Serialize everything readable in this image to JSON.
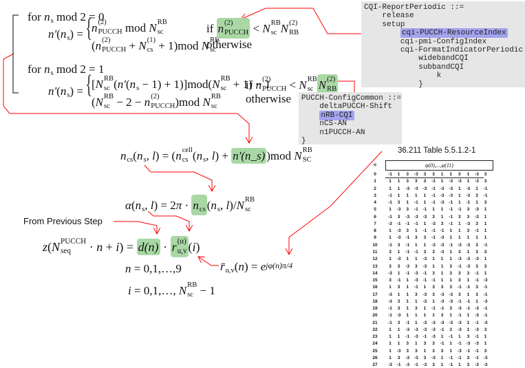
{
  "colors": {
    "highlight_green": "#a9d8a5",
    "highlight_blue": "#a3a3ee",
    "highlight_red": "#e98a86",
    "connector": "#ff0000",
    "code_bg": "#e6e6e6"
  },
  "labels": {
    "for_even": [
      {
        "t": "for "
      },
      {
        "b": "n",
        "sub": "s"
      },
      {
        "t": " mod 2 = 0"
      }
    ],
    "for_odd": [
      {
        "t": "for "
      },
      {
        "b": "n",
        "sub": "s"
      },
      {
        "t": " mod 2 = 1"
      }
    ],
    "from_previous_step": "From Previous  Step"
  },
  "eqs": {
    "nprime_lhs": [
      {
        "b": "n'"
      },
      {
        "t": "("
      },
      {
        "b": "n",
        "sub": "s"
      },
      {
        "t": ") ="
      }
    ],
    "even_case1": [
      {
        "b": "n",
        "sup": "(2)",
        "sub": "PUCCH"
      },
      {
        "t": " mod "
      },
      {
        "b": "N",
        "sup": "RB",
        "sub": "sc"
      }
    ],
    "even_case2": [
      {
        "t": "("
      },
      {
        "b": "n",
        "sup": "(2)",
        "sub": "PUCCH"
      },
      {
        "t": " + "
      },
      {
        "b": "N",
        "sup": "(1)",
        "sub": "cs"
      },
      {
        "t": " + 1)mod "
      },
      {
        "b": "N",
        "sup": "RB",
        "sub": "sc"
      }
    ],
    "even_cond1": [
      {
        "t": "if "
      },
      {
        "b": "n",
        "sup": "(2)",
        "sub": "PUCCH",
        "hl": "green"
      },
      {
        "t": " < "
      },
      {
        "b": "N",
        "sup": "RB",
        "sub": "sc"
      },
      {
        "b": "N",
        "sup": "(2)",
        "sub": "RB"
      }
    ],
    "even_cond2": [
      {
        "t": "otherwise"
      }
    ],
    "odd_case1": [
      {
        "t": "["
      },
      {
        "b": "N",
        "sup": "RB",
        "sub": "sc"
      },
      {
        "t": "("
      },
      {
        "b": "n'"
      },
      {
        "t": "("
      },
      {
        "b": "n",
        "sub": "s"
      },
      {
        "t": " − 1) + 1)]mod("
      },
      {
        "b": "N",
        "sup": "RB",
        "sub": "sc"
      },
      {
        "t": " + 1) − 1"
      }
    ],
    "odd_case2": [
      {
        "t": "("
      },
      {
        "b": "N",
        "sup": "RB",
        "sub": "sc"
      },
      {
        "t": " − 2 − "
      },
      {
        "b": "n",
        "sup": "(2)",
        "sub": "PUCCH"
      },
      {
        "t": ")mod "
      },
      {
        "b": "N",
        "sup": "RB",
        "sub": "sc"
      }
    ],
    "odd_cond1": [
      {
        "t": "if "
      },
      {
        "b": "n",
        "sup": "(2)",
        "sub": "PUCCH"
      },
      {
        "t": " < "
      },
      {
        "b": "N",
        "sup": "RB",
        "sub": "sc"
      },
      {
        "b": "N",
        "sup": "(2)",
        "sub": "RB",
        "hl": "green"
      }
    ],
    "odd_cond2": [
      {
        "t": "otherwise"
      }
    ],
    "ncs": [
      {
        "b": "n",
        "sub": "cs"
      },
      {
        "t": "("
      },
      {
        "b": "n",
        "sub": "s"
      },
      {
        "t": ", "
      },
      {
        "b": "l"
      },
      {
        "t": ") = ("
      },
      {
        "b": "n",
        "sup": "cell",
        "sub": "cs"
      },
      {
        "t": "("
      },
      {
        "b": "n",
        "sub": "s"
      },
      {
        "t": ", "
      },
      {
        "b": "l"
      },
      {
        "t": ") + "
      },
      {
        "b": "n'(n_s)",
        "hl": "green"
      },
      {
        "t": ")mod "
      },
      {
        "b": "N",
        "sup": "RB",
        "sub": "SC"
      }
    ],
    "alpha": [
      {
        "b": "α"
      },
      {
        "t": "("
      },
      {
        "b": "n",
        "sub": "s"
      },
      {
        "t": ", "
      },
      {
        "b": "l"
      },
      {
        "t": ") = 2"
      },
      {
        "b": "π"
      },
      {
        "t": " · "
      },
      {
        "b": "n",
        "sub": "cs",
        "hl": "green"
      },
      {
        "t": "("
      },
      {
        "b": "n",
        "sub": "s"
      },
      {
        "t": ", "
      },
      {
        "b": "l"
      },
      {
        "t": ")/"
      },
      {
        "b": "N",
        "sup": "RB",
        "sub": "sc"
      }
    ],
    "z": [
      {
        "b": "z"
      },
      {
        "t": "("
      },
      {
        "b": "N",
        "sup": "PUCCH",
        "sub": "seq"
      },
      {
        "t": " · "
      },
      {
        "b": "n"
      },
      {
        "t": " + "
      },
      {
        "b": "i"
      },
      {
        "t": ") = "
      },
      {
        "b": "d(n)",
        "hl": "green"
      },
      {
        "t": " · "
      },
      {
        "b": "r",
        "sup": "(α)",
        "sub": "u,v",
        "hl": "green"
      },
      {
        "t": "("
      },
      {
        "b": "i"
      },
      {
        "t": ")"
      }
    ],
    "n_range": [
      {
        "b": "n"
      },
      {
        "t": " = 0,1,…,9"
      }
    ],
    "i_range": [
      {
        "b": "i"
      },
      {
        "t": " = 0,1,…, "
      },
      {
        "b": "N",
        "sup": "RB",
        "sub": "sc"
      },
      {
        "t": " − 1"
      }
    ],
    "rbar": [
      {
        "b": "r̄",
        "sub": "u,v"
      },
      {
        "t": "("
      },
      {
        "b": "n"
      },
      {
        "t": ") = "
      },
      {
        "b": "e"
      },
      {
        "b": "jφ(n)π/4",
        "small": true
      }
    ]
  },
  "cqi_box": {
    "lines": [
      "CQI-ReportPeriodic ::=",
      "    release",
      "    setup",
      "        cqi-PUCCH-ResourceIndex",
      "        cqi-pmi-ConfigIndex",
      "        cqi-FormatIndicatorPeriodic",
      "            widebandCQI",
      "            subbandCQI",
      "                k",
      "            }"
    ],
    "selected_index": 3
  },
  "pucch_box": {
    "lines": [
      "PUCCH-ConfigCommon ::=",
      "    deltaPUCCH-Shift",
      "    nRB-CQI",
      "    nCS-AN",
      "    n1PUCCH-AN",
      "}"
    ],
    "selected_index": 2
  },
  "table": {
    "title": "36.211 Table 5.5.1.2-1",
    "row_header": "u",
    "column_header": "φ(0),...,φ(11)",
    "rows": [
      [
        0,
        -1,
        1,
        3,
        -3,
        3,
        3,
        1,
        1,
        3,
        1,
        -3,
        3
      ],
      [
        1,
        1,
        1,
        3,
        3,
        3,
        -1,
        1,
        -3,
        -3,
        1,
        -3,
        3
      ],
      [
        2,
        1,
        1,
        -3,
        -3,
        -3,
        -1,
        -3,
        -3,
        1,
        -3,
        1,
        -1
      ],
      [
        3,
        -1,
        1,
        1,
        1,
        1,
        -1,
        -3,
        -3,
        1,
        -3,
        3,
        -1
      ],
      [
        4,
        -1,
        3,
        1,
        -1,
        1,
        -1,
        -3,
        -1,
        1,
        -1,
        1,
        3
      ],
      [
        5,
        1,
        -3,
        3,
        -1,
        -1,
        1,
        1,
        -1,
        -1,
        3,
        -3,
        1
      ],
      [
        6,
        -1,
        3,
        -3,
        -3,
        -3,
        3,
        1,
        -1,
        3,
        3,
        -3,
        1
      ],
      [
        7,
        -3,
        -1,
        -1,
        -1,
        1,
        -3,
        3,
        -1,
        1,
        -3,
        3,
        1
      ],
      [
        8,
        1,
        -3,
        3,
        1,
        -1,
        -1,
        -1,
        1,
        1,
        3,
        -1,
        1
      ],
      [
        9,
        1,
        -3,
        -1,
        3,
        3,
        -1,
        -3,
        1,
        1,
        1,
        1,
        1
      ],
      [
        10,
        -1,
        3,
        -1,
        1,
        1,
        -3,
        -3,
        -1,
        -3,
        -3,
        3,
        -1
      ],
      [
        11,
        3,
        1,
        -1,
        -1,
        3,
        3,
        -3,
        1,
        3,
        1,
        3,
        3
      ],
      [
        12,
        1,
        -3,
        1,
        1,
        -3,
        1,
        1,
        1,
        -3,
        -3,
        -3,
        1
      ],
      [
        13,
        3,
        3,
        -3,
        3,
        -3,
        1,
        1,
        3,
        -1,
        -3,
        3,
        3
      ],
      [
        14,
        -3,
        1,
        -1,
        -3,
        -1,
        3,
        1,
        3,
        3,
        3,
        -1,
        1
      ],
      [
        15,
        3,
        -1,
        1,
        -3,
        -1,
        -1,
        1,
        1,
        3,
        1,
        -1,
        -3
      ],
      [
        16,
        1,
        3,
        1,
        -1,
        1,
        3,
        3,
        3,
        -1,
        -1,
        3,
        -1
      ],
      [
        17,
        -3,
        1,
        1,
        3,
        -3,
        3,
        -3,
        -3,
        3,
        1,
        3,
        -1
      ],
      [
        18,
        -3,
        3,
        1,
        1,
        -3,
        1,
        -3,
        -3,
        -1,
        -1,
        1,
        -3
      ],
      [
        19,
        -1,
        3,
        1,
        3,
        1,
        -1,
        -1,
        3,
        -3,
        -1,
        -3,
        -1
      ],
      [
        20,
        -1,
        -3,
        1,
        1,
        1,
        1,
        3,
        1,
        -1,
        1,
        -3,
        -1
      ],
      [
        21,
        -1,
        3,
        -1,
        1,
        -3,
        -3,
        -3,
        -3,
        -3,
        1,
        -1,
        -3
      ],
      [
        22,
        1,
        1,
        -3,
        -3,
        -3,
        -3,
        -1,
        3,
        -3,
        1,
        -3,
        3
      ],
      [
        23,
        1,
        1,
        -1,
        -3,
        -1,
        -3,
        1,
        -1,
        1,
        3,
        -1,
        1
      ],
      [
        24,
        1,
        1,
        3,
        1,
        3,
        3,
        -1,
        1,
        -1,
        -3,
        -3,
        1
      ],
      [
        25,
        1,
        -3,
        3,
        3,
        1,
        3,
        3,
        1,
        -3,
        -1,
        -1,
        3
      ],
      [
        26,
        1,
        3,
        -3,
        -3,
        3,
        -3,
        1,
        -1,
        -1,
        3,
        -1,
        -3
      ],
      [
        27,
        -3,
        -1,
        -3,
        -1,
        -3,
        3,
        1,
        -1,
        1,
        3,
        -3,
        -3
      ]
    ]
  }
}
